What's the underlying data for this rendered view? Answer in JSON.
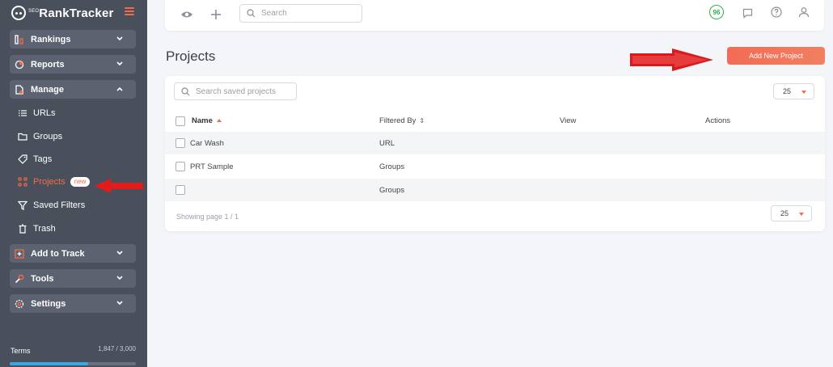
{
  "app": {
    "logo": "RankTracker",
    "logo_prefix": "SEO"
  },
  "sidebar": {
    "groups": {
      "rankings": "Rankings",
      "reports": "Reports",
      "manage": "Manage",
      "add_to_track": "Add to Track",
      "tools": "Tools",
      "settings": "Settings"
    },
    "manage_items": {
      "urls": "URLs",
      "groups": "Groups",
      "tags": "Tags",
      "projects": "Projects",
      "projects_badge": "new",
      "saved_filters": "Saved Filters",
      "trash": "Trash"
    },
    "terms": {
      "label": "Terms",
      "count": "1,847 / 3,000",
      "fill_fraction": 0.62
    }
  },
  "topbar": {
    "search_placeholder": "Search",
    "score": "96"
  },
  "page": {
    "title": "Projects",
    "add_button": "Add New Project"
  },
  "table": {
    "search_placeholder": "Search saved projects",
    "per_page": "25",
    "columns": {
      "name": "Name",
      "filtered_by": "Filtered By",
      "view": "View",
      "actions": "Actions"
    },
    "rows": [
      {
        "name": "Car Wash",
        "filtered_by": "URL"
      },
      {
        "name": "PRT Sample",
        "filtered_by": "Groups"
      },
      {
        "name": "",
        "filtered_by": "Groups"
      }
    ],
    "footer": "Showing page 1 / 1",
    "footer_per_page": "25"
  },
  "colors": {
    "accent": "#f36b4a",
    "sidebar_bg": "#4a4f5c",
    "score_green": "#2bb24c",
    "annotation_red": "#e21b1b"
  }
}
